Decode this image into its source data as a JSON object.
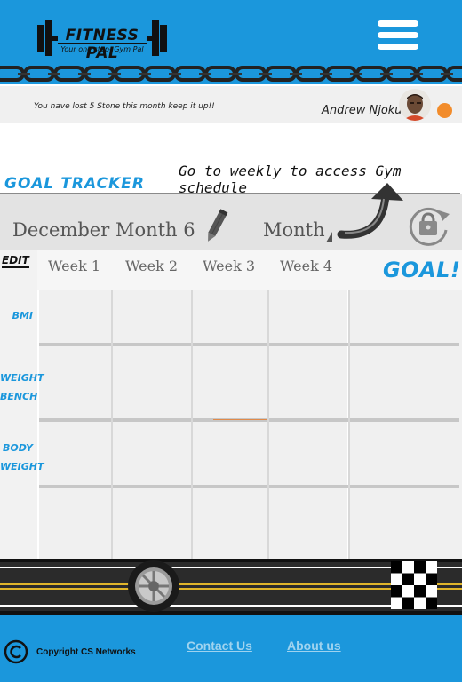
{
  "header": {
    "logo_title": "FITNESS PAL",
    "logo_tagline": "Your one stop- Gym Pal",
    "menu_icon": "hamburger-menu-icon",
    "brand_color": "#1b97dc"
  },
  "status_bar": {
    "message": "You have lost 5 Stone this month keep it up!!",
    "user_name": "Andrew Njoku",
    "status_color": "#f28c2b"
  },
  "tracker": {
    "heading": "GOAL TRACKER",
    "weekly_link": "Go to weekly to access Gym schedule",
    "month_title": "December Month 6",
    "month_label": "Month",
    "edit_label": "EDIT",
    "weeks": [
      "Week 1",
      "Week 2",
      "Week 3",
      "Week 4"
    ],
    "goal_label": "GOAL!",
    "rows": [
      "BMI",
      "WEIGHT BENCH",
      "BODY WEIGHT"
    ]
  },
  "footer": {
    "copyright": "Copyright CS Networks",
    "contact_link": "Contact Us",
    "about_link": "About us"
  }
}
